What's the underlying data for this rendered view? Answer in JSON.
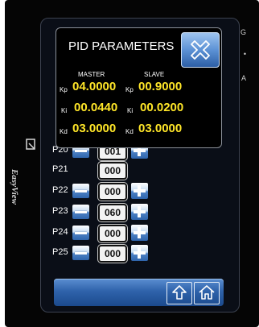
{
  "side_indicators": [
    "G",
    "•",
    "A"
  ],
  "brand": "EasyView",
  "rows": [
    {
      "label": "P20",
      "value": "001"
    },
    {
      "label": "P21",
      "value": "000"
    },
    {
      "label": "P22",
      "value": "000"
    },
    {
      "label": "P23",
      "value": "060"
    },
    {
      "label": "P24",
      "value": "000"
    },
    {
      "label": "P25",
      "value": "000"
    }
  ],
  "popup": {
    "title": "PID PARAMETERS",
    "master_header": "MASTER",
    "slave_header": "SLAVE",
    "params": [
      {
        "key": "Kp",
        "master": "04.0000",
        "slave": "00.9000"
      },
      {
        "key": "Ki",
        "master": "00.0440",
        "slave": "00.0200"
      },
      {
        "key": "Kd",
        "master": "03.0000",
        "slave": "03.0000"
      }
    ]
  },
  "icons": {
    "close": "close-x-icon",
    "up": "up-arrow-icon",
    "home": "home-icon"
  },
  "colors": {
    "value_yellow": "#ffe628",
    "button_blue": "#2f63ab",
    "screen_bg": "#0a0e17"
  }
}
